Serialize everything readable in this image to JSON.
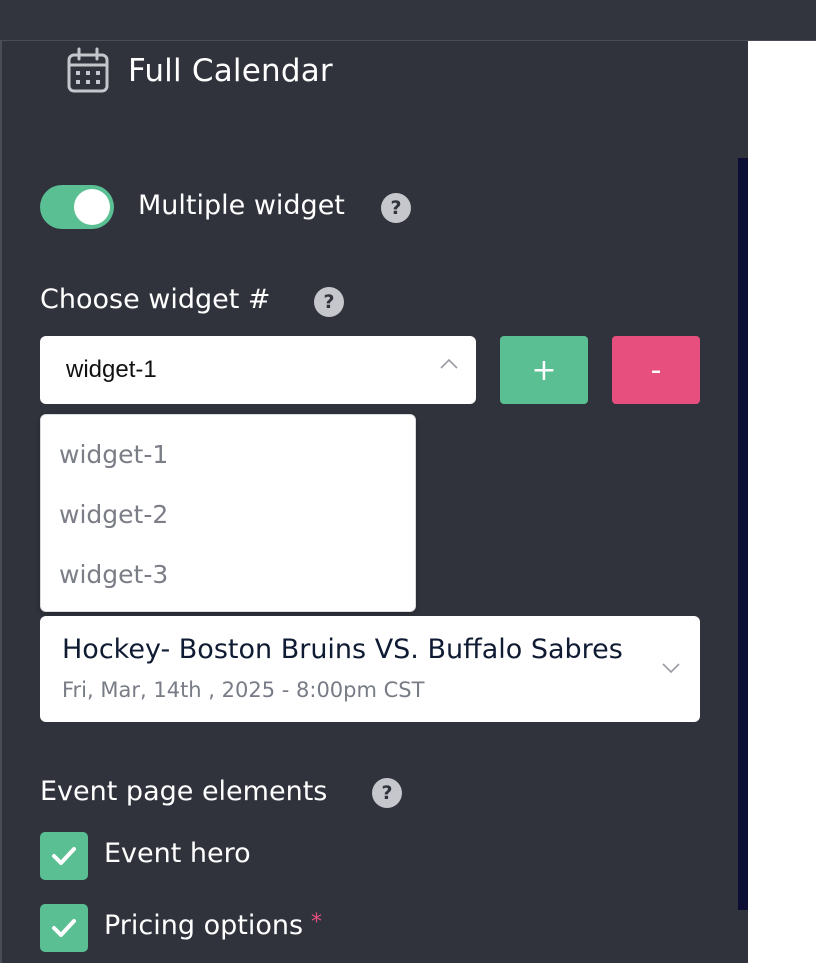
{
  "header": {
    "title": "Full Calendar",
    "icon": "calendar-icon"
  },
  "multiple_widget": {
    "label": "Multiple widget",
    "enabled": true,
    "help": "?"
  },
  "choose_widget": {
    "label": "Choose widget #",
    "help": "?",
    "selected": "widget-1",
    "options": [
      "widget-1",
      "widget-2",
      "widget-3"
    ],
    "add_label": "+",
    "remove_label": "-"
  },
  "event": {
    "title": "Hockey- Boston Bruins VS. Buffalo Sabres",
    "datetime": "Fri, Mar, 14th , 2025 - 8:00pm CST"
  },
  "elements": {
    "label": "Event page elements",
    "help": "?",
    "items": [
      {
        "label": "Event hero",
        "checked": true,
        "required": false
      },
      {
        "label": "Pricing options",
        "checked": true,
        "required": true,
        "required_mark": "*"
      }
    ]
  },
  "colors": {
    "accent_green": "#5bbf94",
    "accent_pink": "#e64f7e",
    "panel_bg": "#30333c"
  }
}
